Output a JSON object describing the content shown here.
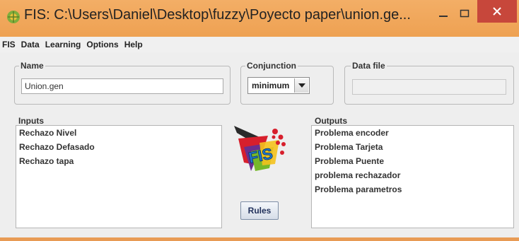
{
  "window": {
    "title": "FIS: C:\\Users\\Daniel\\Desktop\\fuzzy\\Poyecto paper\\union.ge...",
    "titlebar_color": "#f0a65a",
    "close_color": "#c7473b"
  },
  "menu": {
    "items": [
      {
        "label": "FIS"
      },
      {
        "label": "Data"
      },
      {
        "label": "Learning"
      },
      {
        "label": "Options"
      },
      {
        "label": "Help"
      }
    ]
  },
  "name_group": {
    "legend": "Name",
    "value": "Union.gen"
  },
  "conjunction_group": {
    "legend": "Conjunction",
    "selected": "minimum"
  },
  "datafile_group": {
    "legend": "Data file",
    "value": ""
  },
  "inputs": {
    "label": "Inputs",
    "items": [
      {
        "label": "Rechazo Nivel"
      },
      {
        "label": "Rechazo Defasado"
      },
      {
        "label": "Rechazo tapa"
      }
    ]
  },
  "outputs": {
    "label": "Outputs",
    "items": [
      {
        "label": "Problema encoder"
      },
      {
        "label": "Problema Tarjeta"
      },
      {
        "label": "Problema Puente"
      },
      {
        "label": "problema rechazador"
      },
      {
        "label": "Problema parametros"
      }
    ]
  },
  "logo": {
    "text": "FIS",
    "icon": "fis-logo-icon"
  },
  "rules_button": {
    "label": "Rules"
  }
}
